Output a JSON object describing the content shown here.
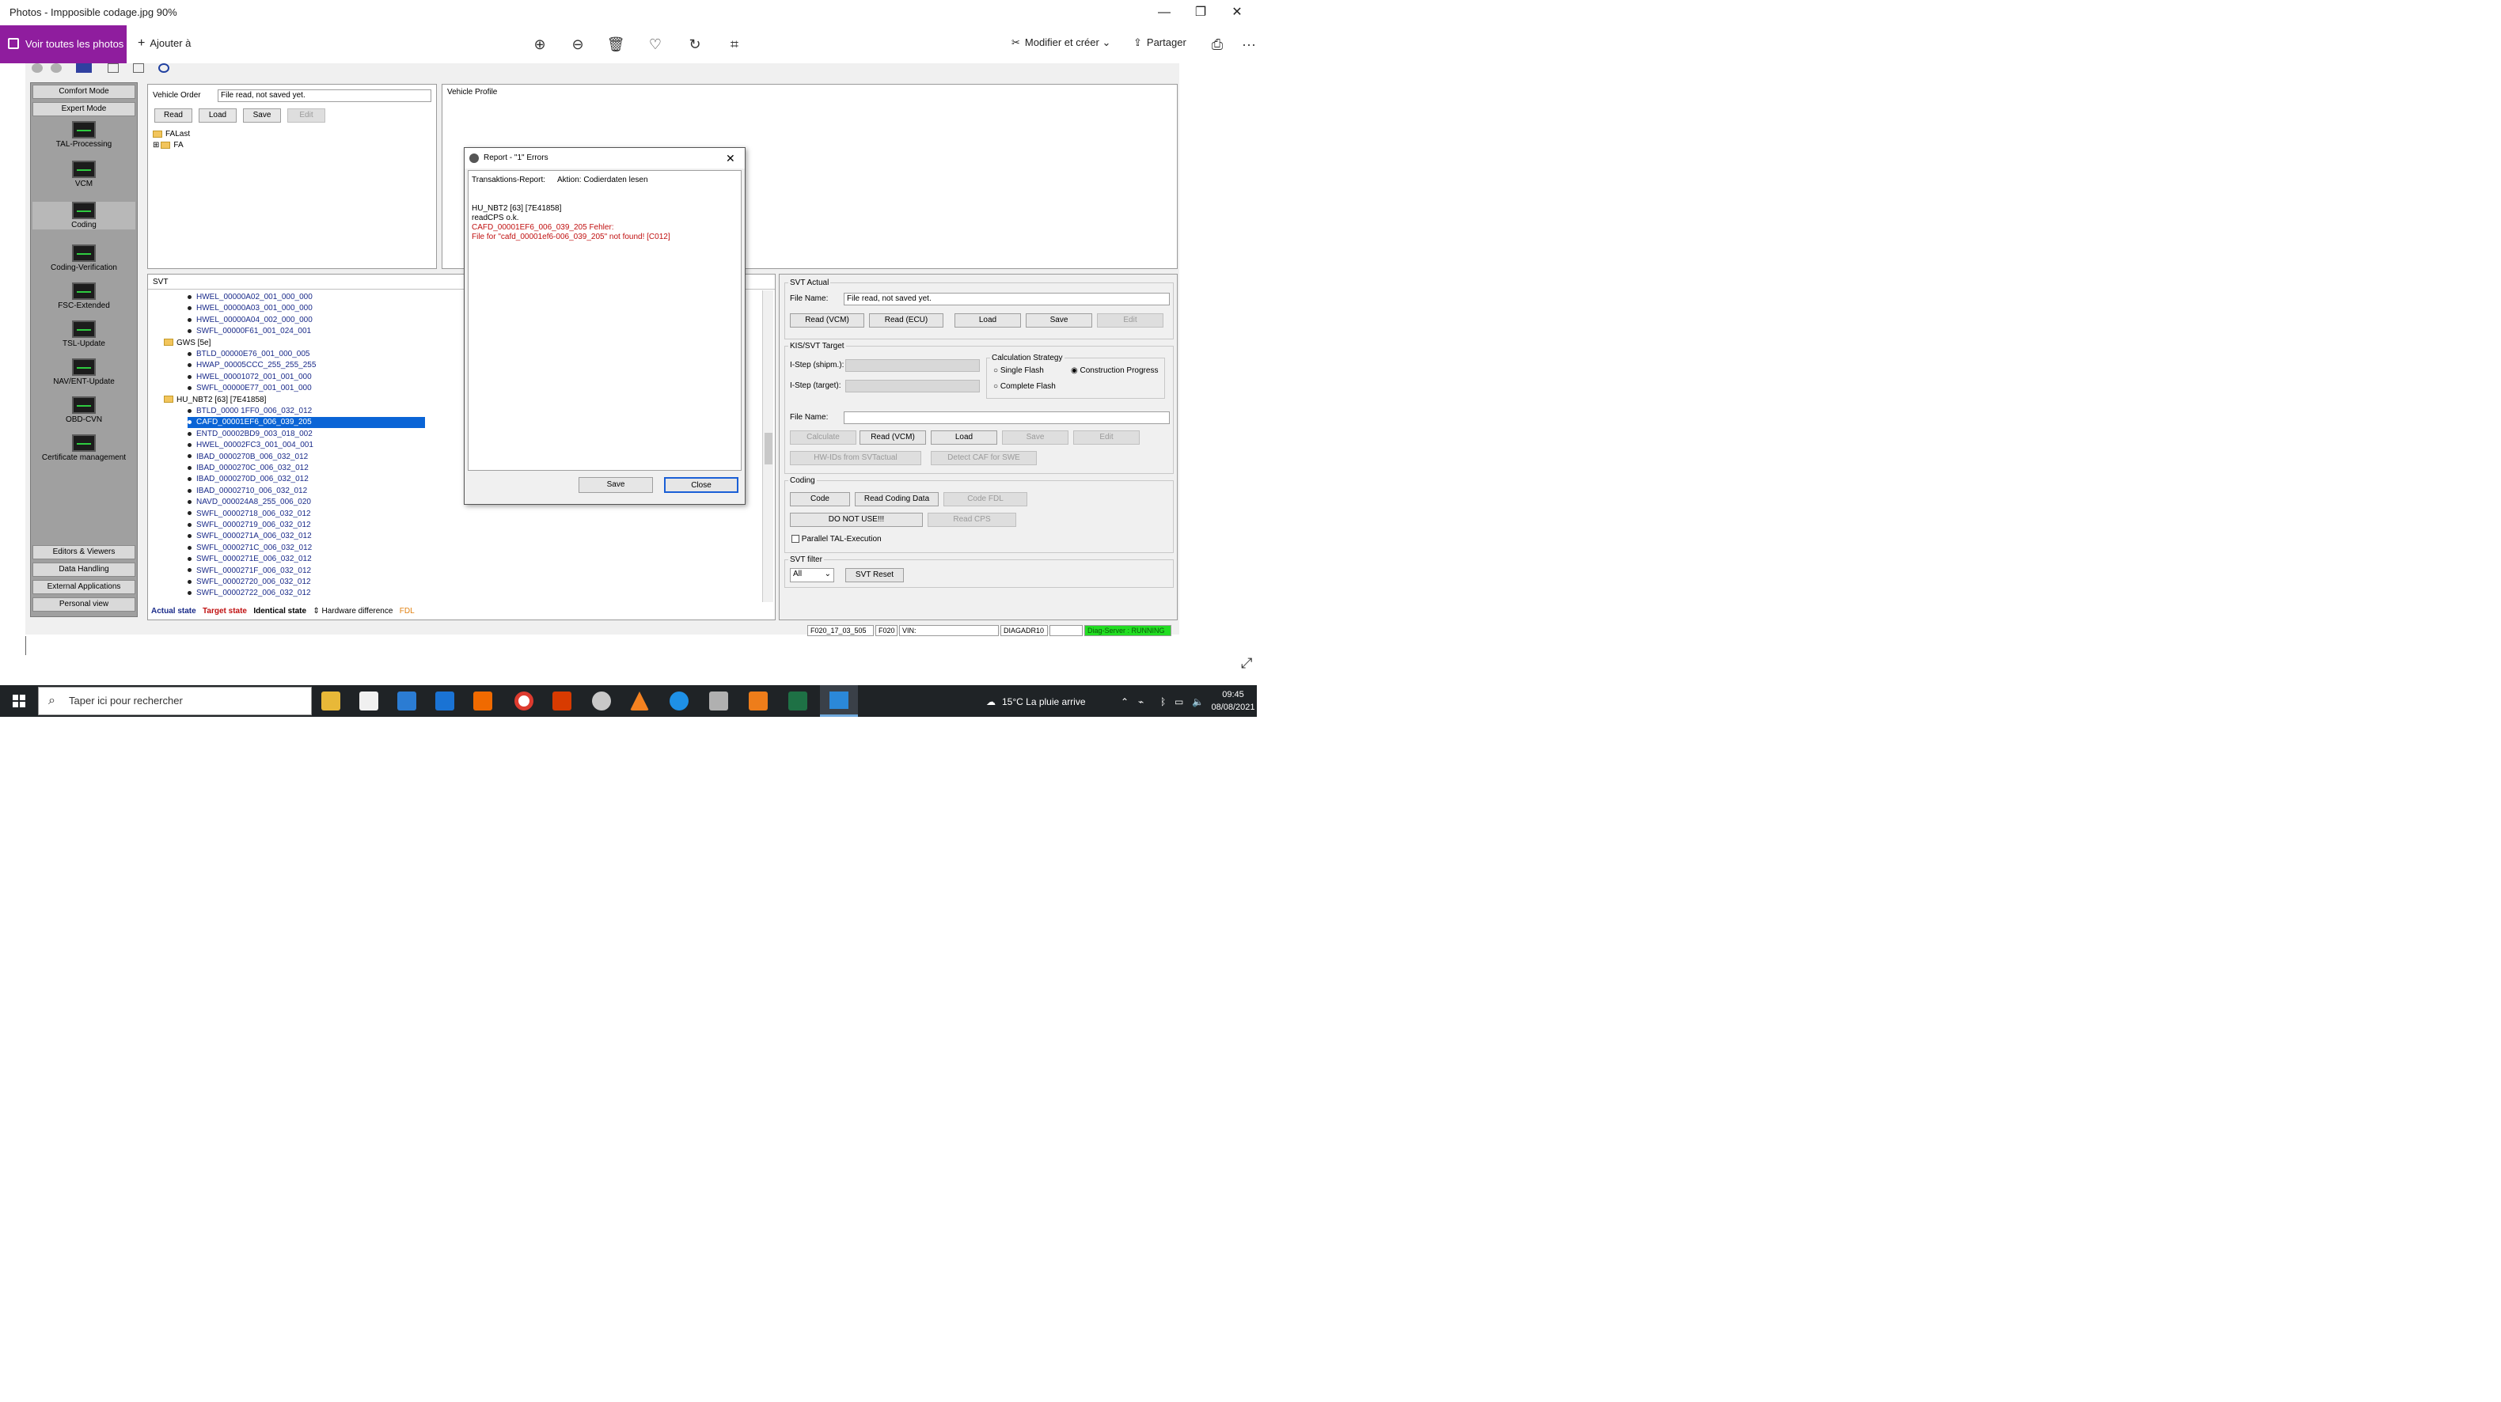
{
  "photos": {
    "title": "Photos - Impposible codage.jpg  90%",
    "view_all": "Voir toutes les photos",
    "add_to": "Ajouter à",
    "edit_create": "Modifier et créer",
    "share": "Partager",
    "more": "···",
    "min": "—",
    "max": "❐",
    "close": "✕"
  },
  "app": {
    "nav": {
      "comfort_mode": "Comfort Mode",
      "expert_mode": "Expert Mode",
      "items": [
        "TAL-Processing",
        "VCM",
        "Coding",
        "Coding-Verification",
        "FSC-Extended",
        "TSL-Update",
        "NAV/ENT-Update",
        "OBD-CVN",
        "Certificate management"
      ],
      "bottom": [
        "Editors & Viewers",
        "Data Handling",
        "External Applications",
        "Personal view"
      ]
    },
    "vehicle_order": {
      "label": "Vehicle Order",
      "value": "File read, not saved yet.",
      "read": "Read",
      "load": "Load",
      "save": "Save",
      "edit": "Edit",
      "tree": [
        "FALast",
        "FA"
      ]
    },
    "vehicle_profile": {
      "label": "Vehicle Profile"
    },
    "svt": {
      "label": "SVT",
      "rows": [
        {
          "text": "HWEL_00000A02_001_000_000",
          "type": "leaf"
        },
        {
          "text": "HWEL_00000A03_001_000_000",
          "type": "leaf"
        },
        {
          "text": "HWEL_00000A04_002_000_000",
          "type": "leaf"
        },
        {
          "text": "SWFL_00000F61_001_024_001",
          "type": "leaf"
        },
        {
          "text": "GWS [5e]",
          "type": "folder"
        },
        {
          "text": "BTLD_00000E76_001_000_005",
          "type": "leaf"
        },
        {
          "text": "HWAP_00005CCC_255_255_255",
          "type": "leaf"
        },
        {
          "text": "HWEL_00001072_001_001_000",
          "type": "leaf"
        },
        {
          "text": "SWFL_00000E77_001_001_000",
          "type": "leaf"
        },
        {
          "text": "HU_NBT2 [63] [7E41858]",
          "type": "folder"
        },
        {
          "text": "BTLD_0000 1FF0_006_032_012",
          "type": "leaf"
        },
        {
          "text": "CAFD_00001EF6_006_039_205",
          "type": "selected"
        },
        {
          "text": "ENTD_00002BD9_003_018_002",
          "type": "leaf"
        },
        {
          "text": "HWEL_00002FC3_001_004_001",
          "type": "leaf"
        },
        {
          "text": "IBAD_0000270B_006_032_012",
          "type": "leaf"
        },
        {
          "text": "IBAD_0000270C_006_032_012",
          "type": "leaf"
        },
        {
          "text": "IBAD_0000270D_006_032_012",
          "type": "leaf"
        },
        {
          "text": "IBAD_00002710_006_032_012",
          "type": "leaf"
        },
        {
          "text": "NAVD_000024A8_255_006_020",
          "type": "leaf"
        },
        {
          "text": "SWFL_00002718_006_032_012",
          "type": "leaf"
        },
        {
          "text": "SWFL_00002719_006_032_012",
          "type": "leaf"
        },
        {
          "text": "SWFL_0000271A_006_032_012",
          "type": "leaf"
        },
        {
          "text": "SWFL_0000271C_006_032_012",
          "type": "leaf"
        },
        {
          "text": "SWFL_0000271E_006_032_012",
          "type": "leaf"
        },
        {
          "text": "SWFL_0000271F_006_032_012",
          "type": "leaf"
        },
        {
          "text": "SWFL_00002720_006_032_012",
          "type": "leaf"
        },
        {
          "text": "SWFL_00002722_006_032_012",
          "type": "leaf"
        }
      ],
      "legend": {
        "actual": "Actual state",
        "target": "Target state",
        "identical": "Identical state",
        "hw": "Hardware difference",
        "fdl": "FDL"
      }
    },
    "svt_actual": {
      "label": "SVT Actual",
      "file_name_label": "File Name:",
      "file_name": "File read, not saved yet.",
      "read_vcm": "Read (VCM)",
      "read_ecu": "Read (ECU)",
      "load": "Load",
      "save": "Save",
      "edit": "Edit"
    },
    "kis_target": {
      "label": "KIS/SVT Target",
      "istep_shipm": "I-Step (shipm.):",
      "istep_target": "I-Step (target):",
      "calc_strategy": "Calculation Strategy",
      "single_flash": "Single Flash",
      "complete_flash": "Complete Flash",
      "construction_progress": "Construction Progress",
      "file_name_label": "File Name:",
      "calculate": "Calculate",
      "read_vcm": "Read (VCM)",
      "load": "Load",
      "save": "Save",
      "edit": "Edit",
      "hw_ids": "HW-IDs from SVTactual",
      "detect_caf": "Detect CAF for SWE"
    },
    "coding": {
      "label": "Coding",
      "code": "Code",
      "read_coding": "Read Coding Data",
      "code_fdl": "Code FDL",
      "do_not_use": "DO NOT USE!!!",
      "read_cps": "Read CPS",
      "parallel": "Parallel TAL-Execution"
    },
    "svt_filter": {
      "label": "SVT filter",
      "value": "All",
      "reset": "SVT Reset"
    },
    "status": {
      "s1": "F020_17_03_505",
      "s2": "F020",
      "vin": "VIN:",
      "diag": "DIAGADR10",
      "server": "Diag-Server : RUNNING"
    }
  },
  "dialog": {
    "title": "Report - \"1\" Errors",
    "trans_label": "Transaktions-Report:",
    "action": "Aktion: Codierdaten lesen",
    "line1": "HU_NBT2 [63] [7E41858]",
    "line2": "readCPS o.k.",
    "err1": "CAFD_00001EF6_006_039_205 Fehler:",
    "err2": "File for \"cafd_00001ef6-006_039_205\" not found! [C012]",
    "save": "Save",
    "close": "Close"
  },
  "taskbar": {
    "search": "Taper ici pour rechercher",
    "weather": "15°C  La pluie arrive",
    "time": "09:45",
    "date": "08/08/2021"
  },
  "colors": {
    "accent": "#8f1d9e",
    "selection": "#0a64d6",
    "error": "#c01010",
    "server_ok": "#22dd22",
    "taskbar": "#1f2326"
  }
}
